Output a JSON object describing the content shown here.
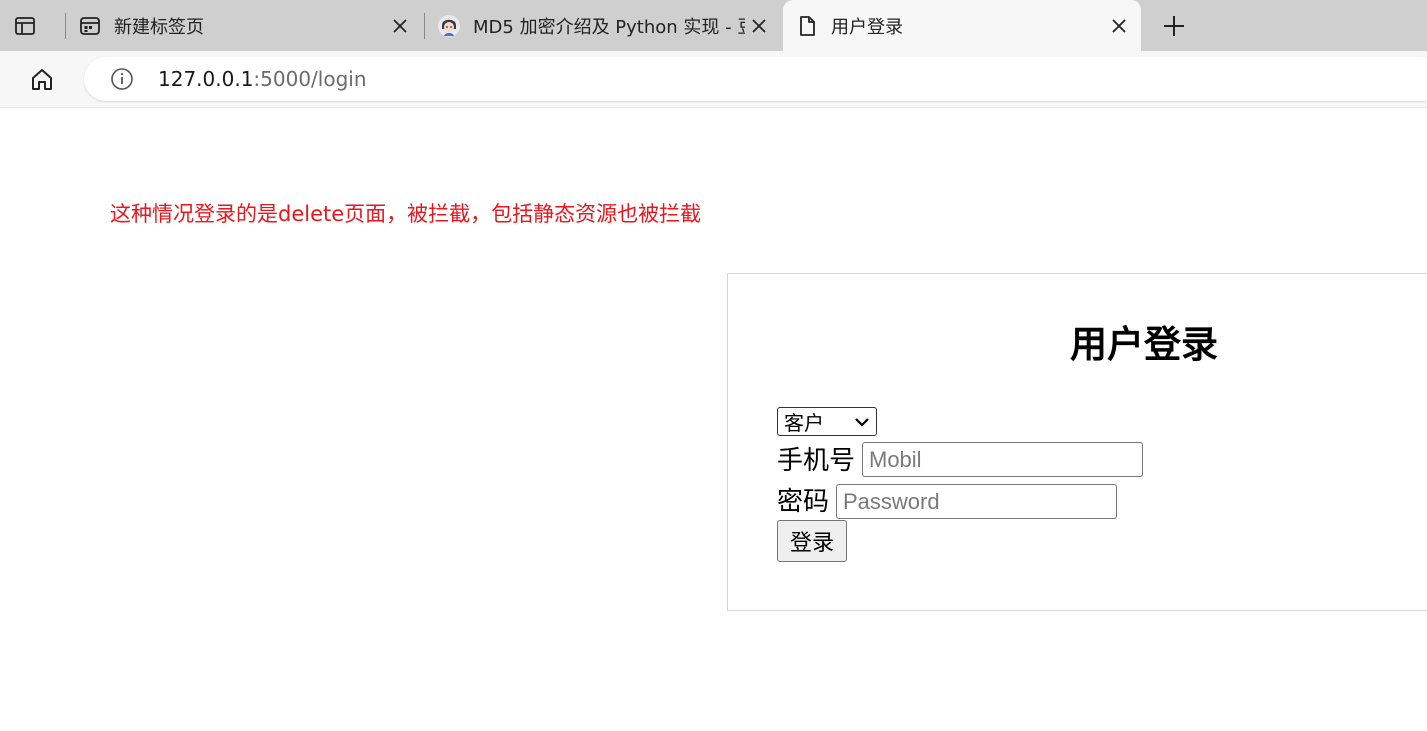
{
  "browser": {
    "tabs": [
      {
        "title": "新建标签页",
        "favicon": "new-tab-page-icon",
        "active": false
      },
      {
        "title": "MD5 加密介绍及 Python 实现 - 豆",
        "favicon": "avatar-icon",
        "active": false
      },
      {
        "title": "用户登录",
        "favicon": "document-icon",
        "active": true
      }
    ],
    "address": {
      "host": "127.0.0.1",
      "path": ":5000/login"
    }
  },
  "page": {
    "note": "这种情况登录的是delete页面，被拦截，包括静态资源也被拦截",
    "login": {
      "title": "用户登录",
      "role_selected": "客户",
      "phone_label": "手机号",
      "phone_placeholder": "Mobil",
      "password_label": "密码",
      "password_placeholder": "Password",
      "submit_label": "登录"
    }
  },
  "colors": {
    "note": "#e8161d",
    "tabstrip": "#cfcfcf",
    "active_tab": "#f7f7f7"
  }
}
